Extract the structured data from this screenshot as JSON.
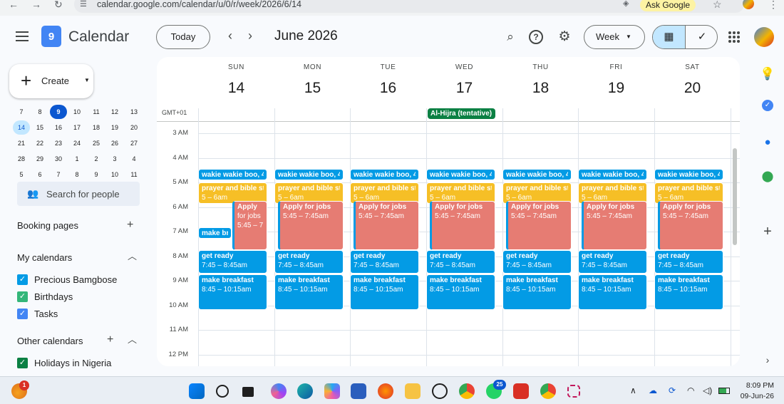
{
  "browser": {
    "url": "calendar.google.com/calendar/u/0/r/week/2026/6/14",
    "ask_google": "Ask Google"
  },
  "header": {
    "app_name": "Calendar",
    "logo_text": "9",
    "today": "Today",
    "month_title": "June 2026",
    "view": "Week"
  },
  "sidebar": {
    "create": "Create",
    "mini_calendar": [
      [
        "7",
        "8",
        "9",
        "10",
        "11",
        "12",
        "13"
      ],
      [
        "14",
        "15",
        "16",
        "17",
        "18",
        "19",
        "20"
      ],
      [
        "21",
        "22",
        "23",
        "24",
        "25",
        "26",
        "27"
      ],
      [
        "28",
        "29",
        "30",
        "1",
        "2",
        "3",
        "4"
      ],
      [
        "5",
        "6",
        "7",
        "8",
        "9",
        "10",
        "11"
      ]
    ],
    "search_people": "Search for people",
    "booking_pages": "Booking pages",
    "my_calendars": "My calendars",
    "my_calendar_items": [
      {
        "label": "Precious Bamgbose",
        "color": "#039be5"
      },
      {
        "label": "Birthdays",
        "color": "#33b679"
      },
      {
        "label": "Tasks",
        "color": "#4285f4"
      }
    ],
    "other_calendars": "Other calendars",
    "other_calendar_items": [
      {
        "label": "Holidays in Nigeria",
        "color": "#0b8043"
      }
    ]
  },
  "week": {
    "timezone": "GMT+01",
    "days": [
      {
        "name": "SUN",
        "num": "14"
      },
      {
        "name": "MON",
        "num": "15"
      },
      {
        "name": "TUE",
        "num": "16"
      },
      {
        "name": "WED",
        "num": "17"
      },
      {
        "name": "THU",
        "num": "18"
      },
      {
        "name": "FRI",
        "num": "19"
      },
      {
        "name": "SAT",
        "num": "20"
      }
    ],
    "hours": [
      "3 AM",
      "4 AM",
      "5 AM",
      "6 AM",
      "7 AM",
      "8 AM",
      "9 AM",
      "10 AM",
      "11 AM",
      "12 PM"
    ],
    "allday_event": "Al-Hijra (tentative)",
    "events": {
      "wake": "wakie wakie boo, 4",
      "wake_short": "wakie wakie boo, 4",
      "prayer_title": "prayer and bible st",
      "prayer_time": "5 – 6am",
      "apply_title": "Apply for jobs",
      "apply_time": "5:45 – 7:45am",
      "apply_sun_title1": "Apply",
      "apply_sun_title2": "for jobs",
      "apply_sun_time": "5:45 – 7:",
      "make_bre": "make bre",
      "ready_title": "get ready",
      "ready_time": "7:45 – 8:45am",
      "breakfast_title": "make breakfast",
      "breakfast_time": "8:45 – 10:15am"
    },
    "event_colors": {
      "routine": "#039be5",
      "prayer": "#f6bf26",
      "jobs": "#e67c73",
      "holiday": "#0b8043"
    }
  },
  "taskbar": {
    "time": "8:09 PM",
    "date": "09-Jun-26",
    "weather_badge": "1",
    "whatsapp_badge": "25"
  }
}
